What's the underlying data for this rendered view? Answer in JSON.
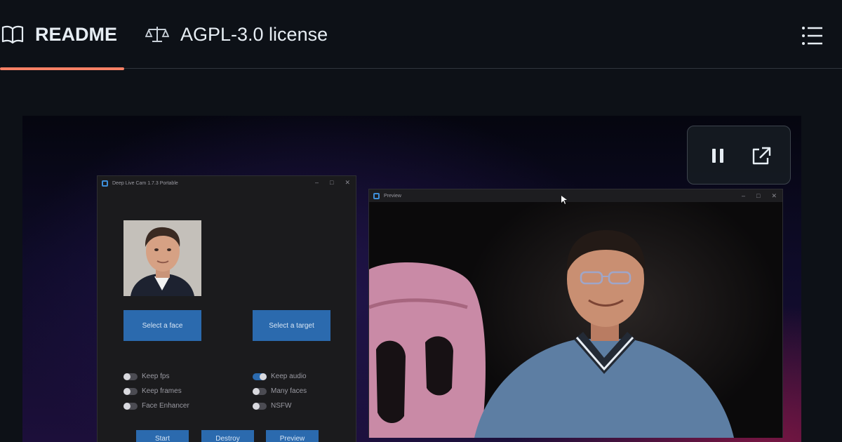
{
  "tabs": {
    "readme": {
      "label": "README",
      "icon": "book-icon",
      "active": true
    },
    "license": {
      "label": "AGPL-3.0 license",
      "icon": "scale-icon"
    }
  },
  "toolbar": {
    "outline_icon": "list-icon"
  },
  "accent": "#f78166",
  "video": {
    "controls": {
      "pause_icon": "pause-icon",
      "popout_icon": "external-link-icon"
    },
    "app_window": {
      "title": "Deep Live Cam 1.7.3 Portable",
      "buttons": {
        "select_face": "Select a face",
        "select_target": "Select a target",
        "start": "Start",
        "destroy": "Destroy",
        "preview": "Preview"
      },
      "toggles_left": [
        {
          "label": "Keep fps",
          "on": false
        },
        {
          "label": "Keep frames",
          "on": false
        },
        {
          "label": "Face Enhancer",
          "on": false
        }
      ],
      "toggles_right": [
        {
          "label": "Keep audio",
          "on": true
        },
        {
          "label": "Many faces",
          "on": false
        },
        {
          "label": "NSFW",
          "on": false
        }
      ]
    },
    "preview_window": {
      "title": "Preview"
    }
  }
}
